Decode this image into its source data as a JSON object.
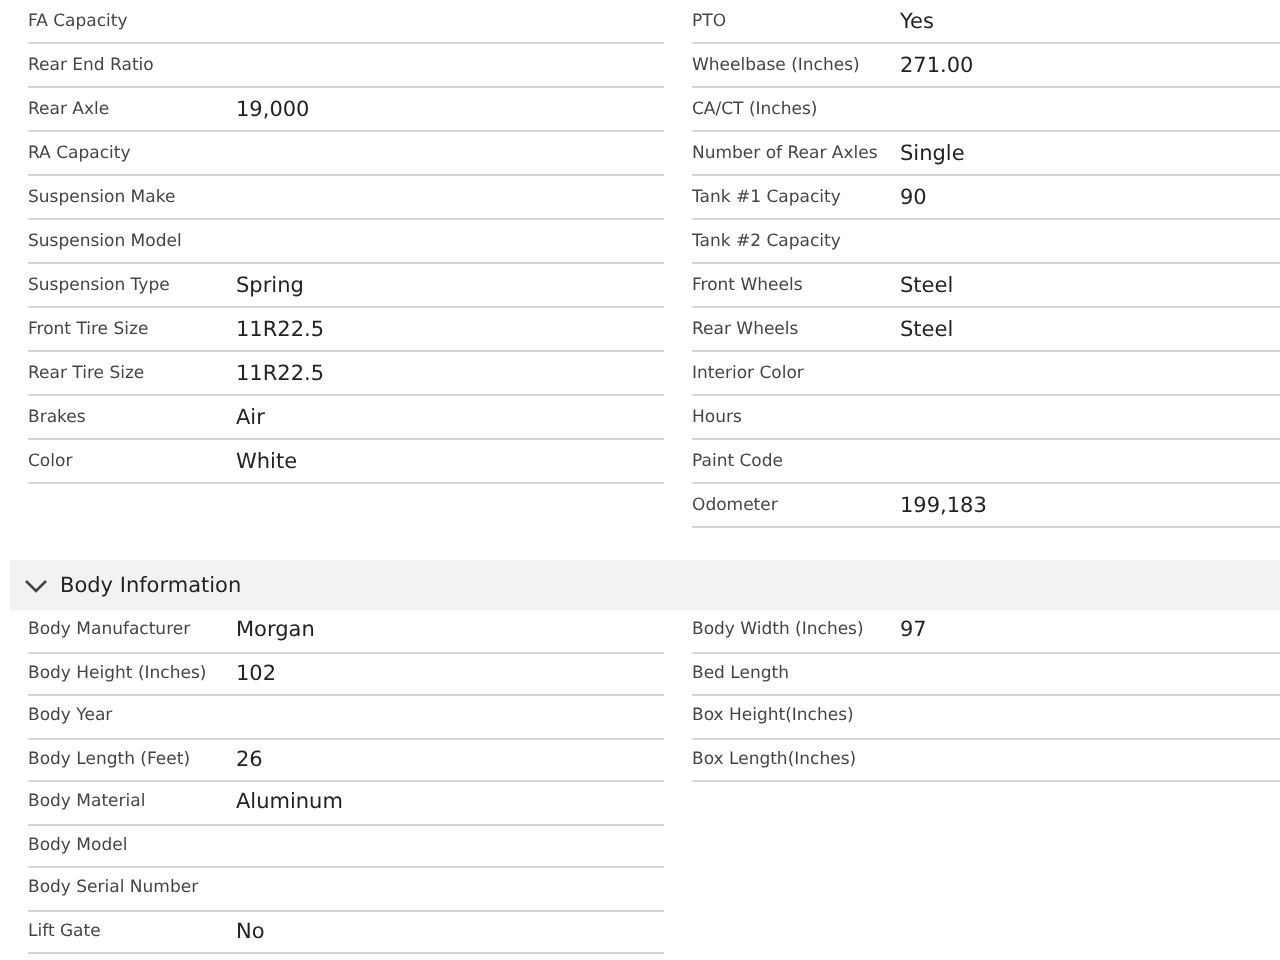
{
  "vehicle_details": {
    "left": [
      {
        "label": "FA Capacity"
      },
      {
        "label": "Rear End Ratio"
      },
      {
        "label": "Rear Axle",
        "value": "19,000"
      },
      {
        "label": "RA Capacity"
      },
      {
        "label": "Suspension Make"
      },
      {
        "label": "Suspension Model"
      },
      {
        "label": "Suspension Type",
        "value": "Spring"
      },
      {
        "label": "Front Tire Size",
        "value": "11R22.5"
      },
      {
        "label": "Rear Tire Size",
        "value": "11R22.5"
      },
      {
        "label": "Brakes",
        "value": "Air"
      },
      {
        "label": "Color",
        "value": "White"
      }
    ],
    "right": [
      {
        "label": "PTO",
        "value": "Yes"
      },
      {
        "label": "Wheelbase (Inches)",
        "value": "271.00"
      },
      {
        "label": "CA/CT (Inches)"
      },
      {
        "label": "Number of Rear Axles",
        "value": "Single"
      },
      {
        "label": "Tank #1 Capacity",
        "value": "90"
      },
      {
        "label": "Tank #2 Capacity"
      },
      {
        "label": "Front Wheels",
        "value": "Steel"
      },
      {
        "label": "Rear Wheels",
        "value": "Steel"
      },
      {
        "label": "Interior Color"
      },
      {
        "label": "Hours"
      },
      {
        "label": "Paint Code"
      },
      {
        "label": "Odometer",
        "value": "199,183"
      }
    ]
  },
  "body_information": {
    "title": "Body Information",
    "expanded": true,
    "left": [
      {
        "label": "Body Manufacturer",
        "value": "Morgan"
      },
      {
        "label": "Body Height (Inches)",
        "value": "102"
      },
      {
        "label": "Body Year"
      },
      {
        "label": "Body Length (Feet)",
        "value": "26"
      },
      {
        "label": "Body Material",
        "value": "Aluminum"
      },
      {
        "label": "Body Model"
      },
      {
        "label": "Body Serial Number"
      },
      {
        "label": "Lift Gate",
        "value": "No"
      }
    ],
    "right": [
      {
        "label": "Body Width (Inches)",
        "value": "97"
      },
      {
        "label": "Bed Length"
      },
      {
        "label": "Box Height(Inches)"
      },
      {
        "label": "Box Length(Inches)"
      }
    ]
  }
}
